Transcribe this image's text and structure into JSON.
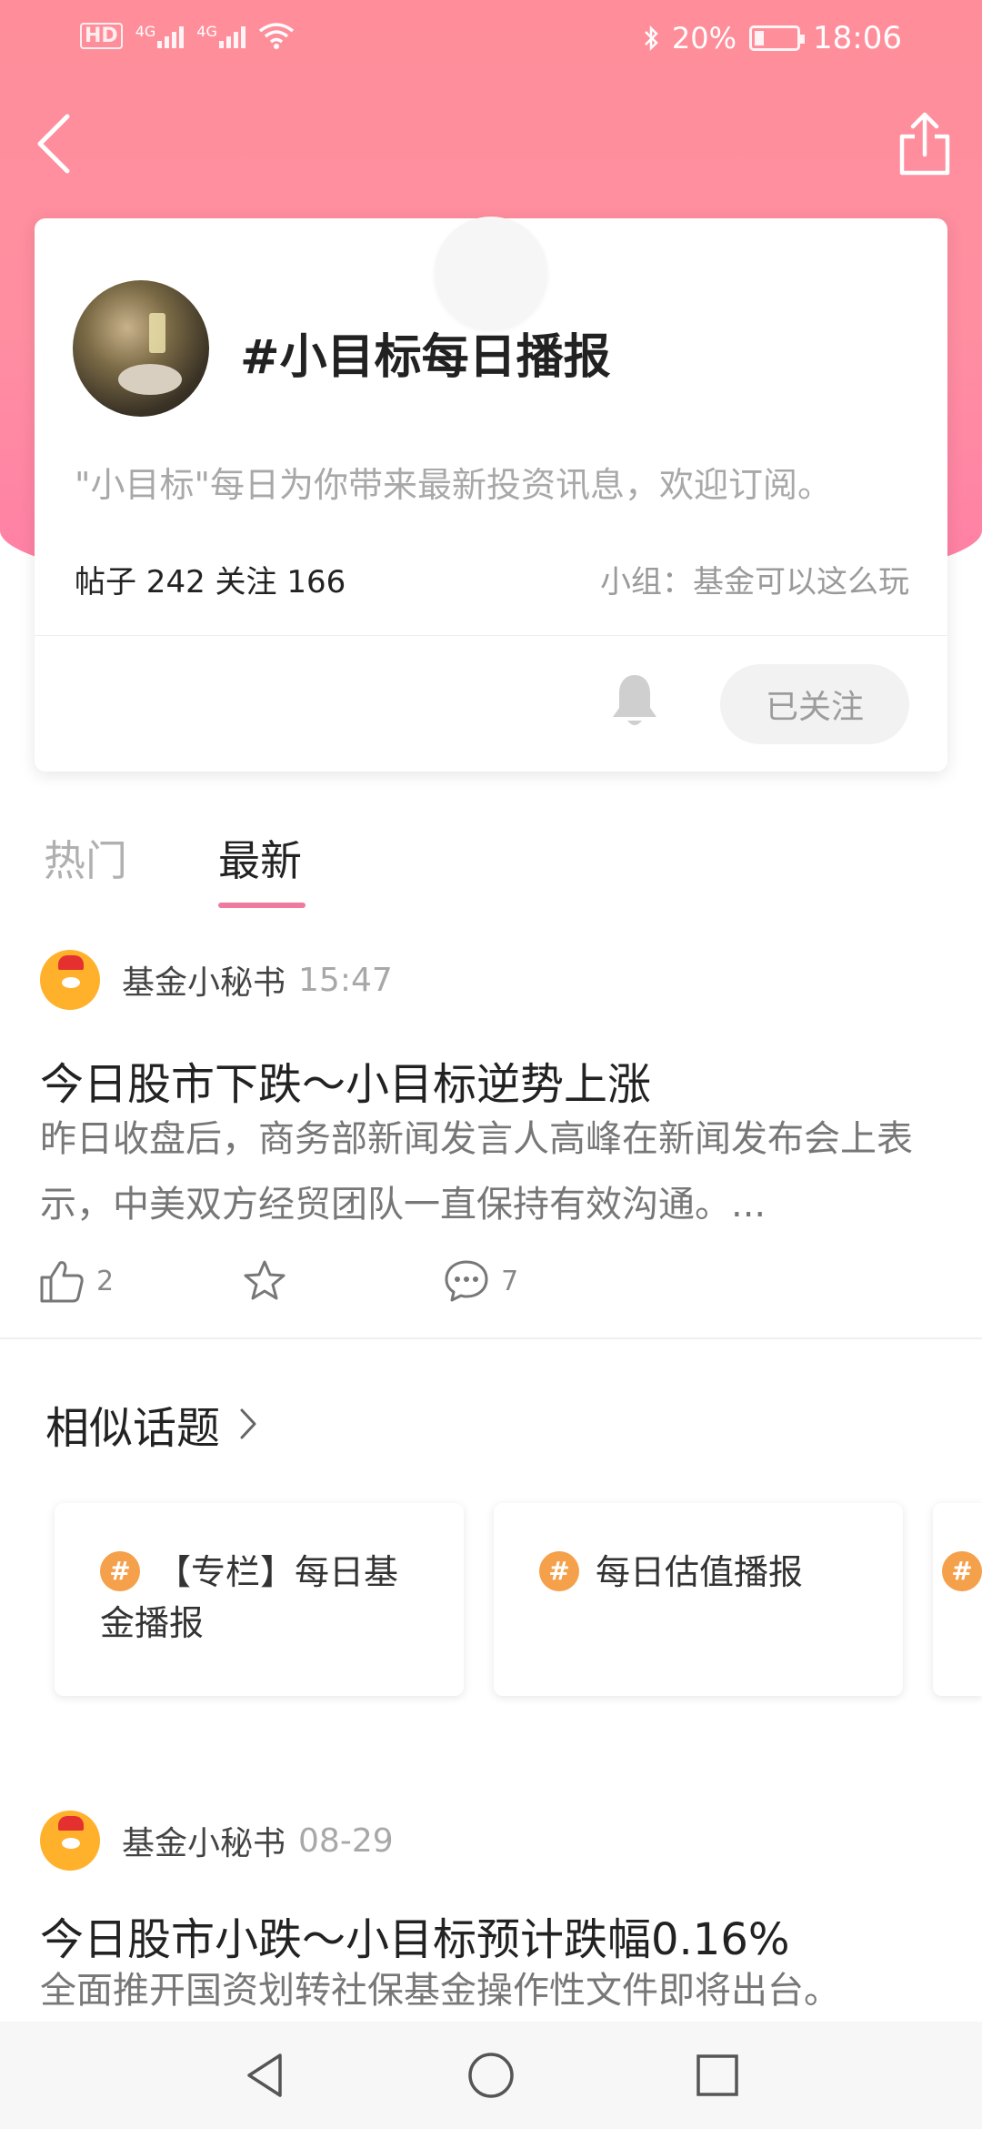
{
  "status_bar": {
    "network_badge": "HD",
    "sim1_label": "4G",
    "sim2_label": "4G",
    "battery_percent": "20%",
    "time": "18:06",
    "icons": [
      "bluetooth-icon",
      "wifi-icon",
      "battery-icon"
    ]
  },
  "header": {
    "back_icon": "chevron-left-icon",
    "share_icon": "share-icon"
  },
  "topic": {
    "title": "#小目标每日播报",
    "description": "\"小目标\"每日为你带来最新投资讯息，欢迎订阅。",
    "stats": "帖子 242  关注 166",
    "group": "小组：基金可以这么玩",
    "follow_label": "已关注",
    "bell_icon": "bell-icon"
  },
  "tabs": [
    {
      "label": "热门",
      "active": false
    },
    {
      "label": "最新",
      "active": true
    }
  ],
  "posts": [
    {
      "author": "基金小秘书",
      "time": "15:47",
      "title": "今日股市下跌～小目标逆势上涨",
      "excerpt": "昨日收盘后，商务部新闻发言人高峰在新闻发布会上表示，中美双方经贸团队一直保持有效沟通。...",
      "likes": "2",
      "comments": "7"
    },
    {
      "author": "基金小秘书",
      "time": "08-29",
      "title": "今日股市小跌～小目标预计跌幅0.16%",
      "excerpt": "全面推开国资划转社保基金操作性文件即将出台。"
    }
  ],
  "similar": {
    "title": "相似话题",
    "topics": [
      {
        "label": "【专栏】每日基金播报"
      },
      {
        "label": "每日估值播报"
      },
      {
        "label": ""
      }
    ]
  },
  "colors": {
    "header_pink": "#ff8ea1",
    "tab_accent": "#ee7aa0",
    "hash_orange": "#f5a04b"
  }
}
